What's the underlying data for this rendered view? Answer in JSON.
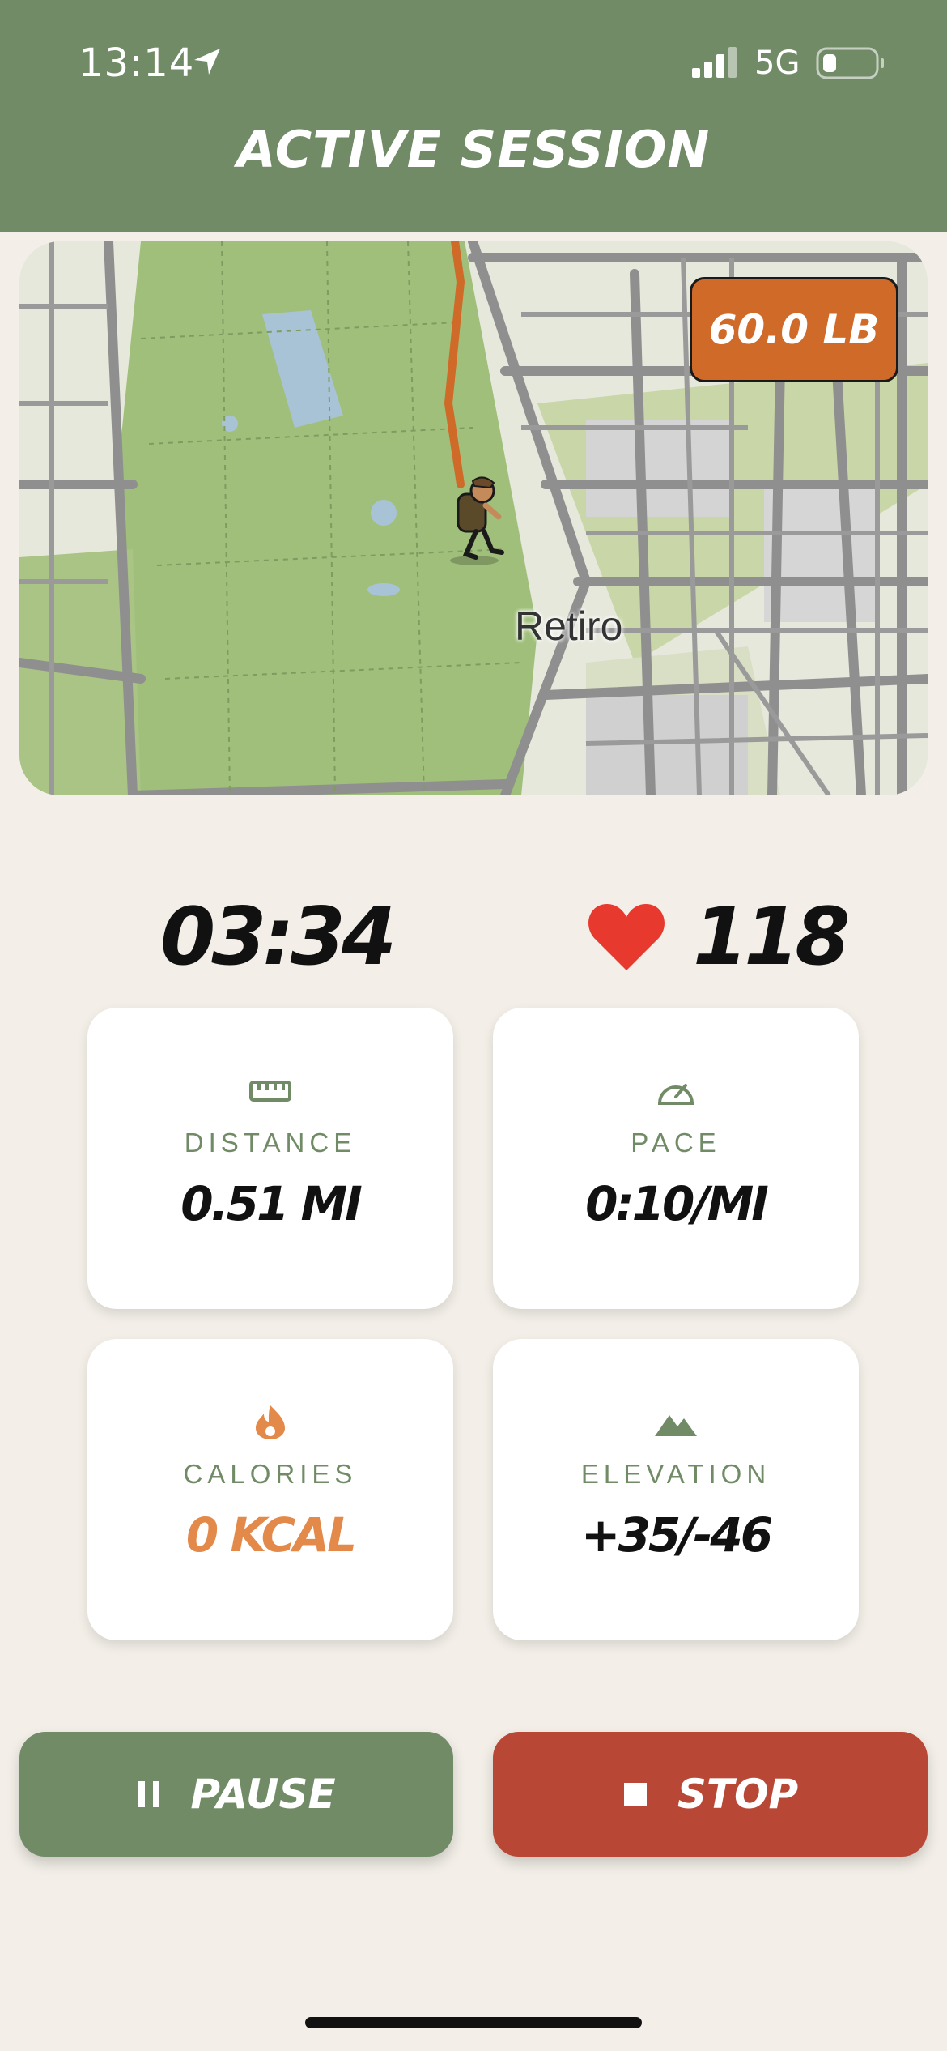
{
  "status_bar": {
    "time": "13:14",
    "network": "5G",
    "icons": [
      "location-arrow-icon",
      "signal-icon",
      "battery-icon"
    ]
  },
  "header": {
    "title": "ACTIVE SESSION"
  },
  "map": {
    "weight_badge": "60.0 LB",
    "place_label": "Retiro",
    "marker": "hiker-icon"
  },
  "stats": {
    "timer": "03:34",
    "heart_rate": "118"
  },
  "cards": [
    {
      "icon": "ruler-icon",
      "label": "DISTANCE",
      "value": "0.51 MI"
    },
    {
      "icon": "speedometer-icon",
      "label": "PACE",
      "value": "0:10/MI"
    },
    {
      "icon": "flame-icon",
      "label": "CALORIES",
      "value": "0 KCAL"
    },
    {
      "icon": "mountain-icon",
      "label": "ELEVATION",
      "value": "+35/-46"
    }
  ],
  "actions": {
    "pause_label": "PAUSE",
    "stop_label": "STOP"
  },
  "colors": {
    "header": "#718b66",
    "accent_orange": "#d06a28",
    "stop_red": "#b94735",
    "background": "#f3efe8"
  }
}
